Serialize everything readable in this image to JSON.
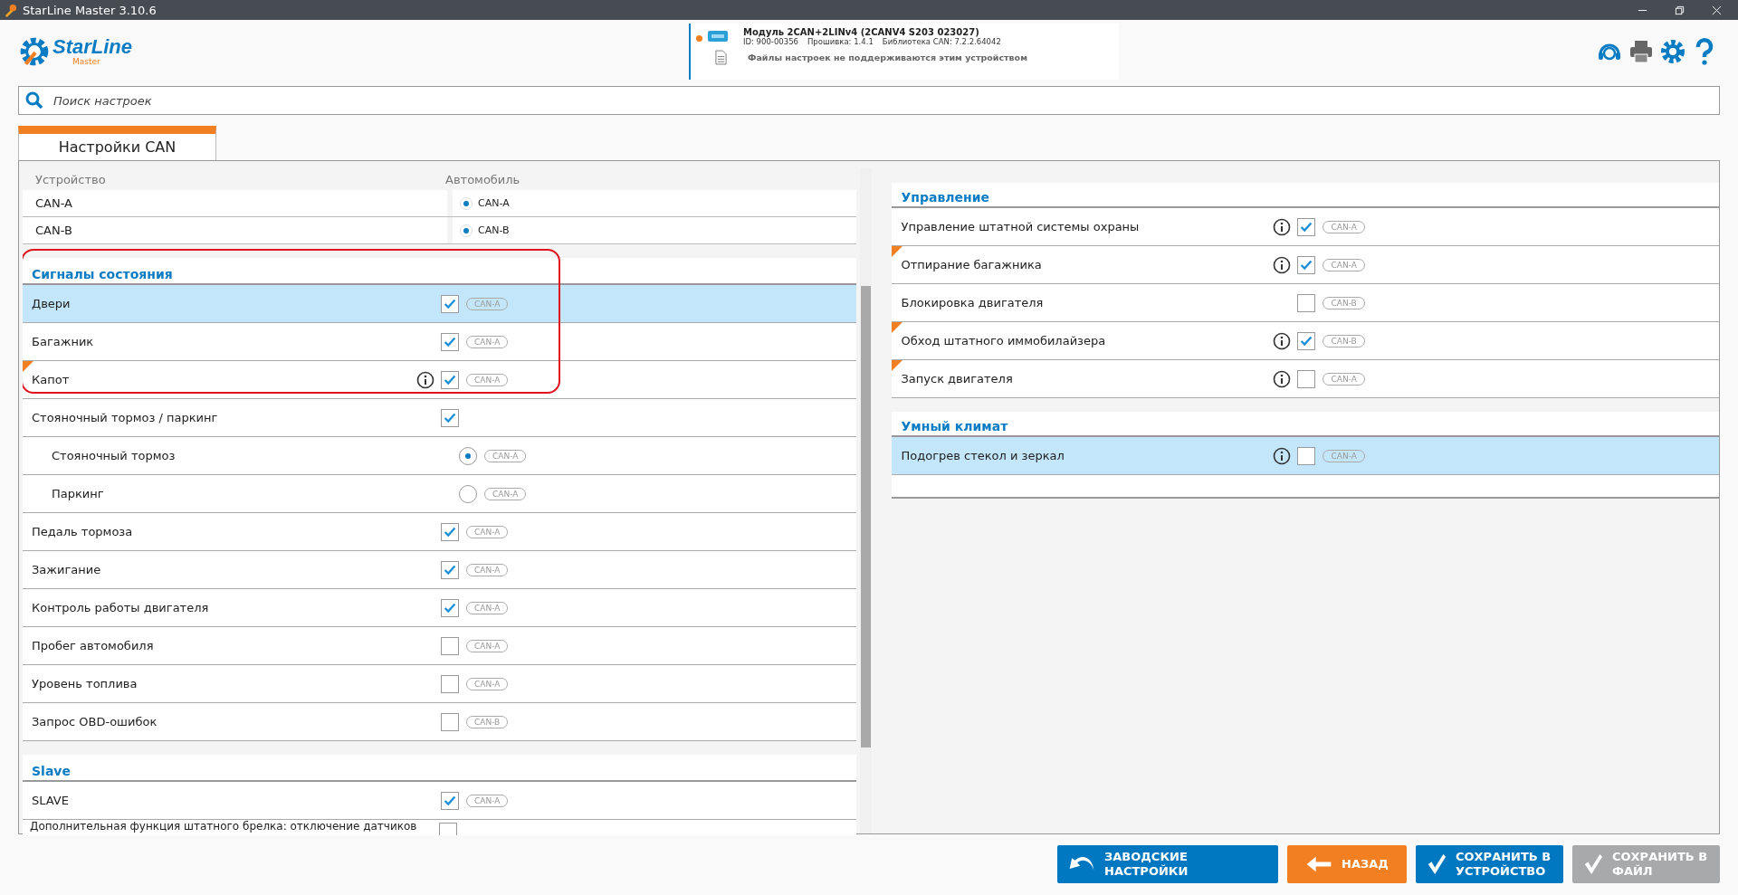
{
  "window": {
    "title": "StarLine Master 3.10.6"
  },
  "logo": {
    "name": "StarLine",
    "sub": "Master"
  },
  "device": {
    "connected": true,
    "name": "Модуль 2CAN+2LINv4 (2CANV4 S203 023027)",
    "id": "ID: 900-00356",
    "firmware": "Прошивка: 1.4.1",
    "library": "Библиотека CAN: 7.2.2.64042",
    "notice": "Файлы настроек не поддерживаются этим устройством"
  },
  "search": {
    "placeholder": "Поиск настроек"
  },
  "tabs": [
    {
      "label": "Настройки CAN",
      "selected": true
    }
  ],
  "bus_table": {
    "columns": [
      "Устройство",
      "Автомобиль"
    ],
    "rows": [
      {
        "label": "CAN-A",
        "value": "CAN-A",
        "selected": true
      },
      {
        "label": "CAN-B",
        "value": "CAN-B",
        "selected": true
      }
    ]
  },
  "left_sections": [
    {
      "title": "Сигналы состояния",
      "rows": [
        {
          "label": "Двери",
          "kind": "check",
          "checked": true,
          "bus": "CAN-A",
          "highlighted": true
        },
        {
          "label": "Багажник",
          "kind": "check",
          "checked": true,
          "bus": "CAN-A"
        },
        {
          "label": "Капот",
          "kind": "check",
          "checked": true,
          "bus": "CAN-A",
          "info": true,
          "flagged": true
        },
        {
          "label": "Стояночный тормоз / паркинг",
          "kind": "check",
          "checked": true,
          "children": [
            {
              "label": "Стояночный тормоз",
              "kind": "radio",
              "selected": true,
              "bus": "CAN-A"
            },
            {
              "label": "Паркинг",
              "kind": "radio",
              "selected": false,
              "bus": "CAN-A"
            }
          ]
        },
        {
          "label": "Педаль тормоза",
          "kind": "check",
          "checked": true,
          "bus": "CAN-A"
        },
        {
          "label": "Зажигание",
          "kind": "check",
          "checked": true,
          "bus": "CAN-A"
        },
        {
          "label": "Контроль работы двигателя",
          "kind": "check",
          "checked": true,
          "bus": "CAN-A"
        },
        {
          "label": "Пробег автомобиля",
          "kind": "check",
          "checked": false,
          "bus": "CAN-A"
        },
        {
          "label": "Уровень топлива",
          "kind": "check",
          "checked": false,
          "bus": "CAN-A"
        },
        {
          "label": "Запрос OBD-ошибок",
          "kind": "check",
          "checked": false,
          "bus": "CAN-B"
        }
      ]
    },
    {
      "title": "Slave",
      "rows": [
        {
          "label": "SLAVE",
          "kind": "check",
          "checked": true,
          "bus": "CAN-A"
        },
        {
          "label": "Дополнительная функция штатного брелка: отключение датчиков",
          "kind": "check",
          "checked": false
        }
      ]
    }
  ],
  "right_sections": [
    {
      "title": "Управление",
      "rows": [
        {
          "label": "Управление штатной системы охраны",
          "kind": "check",
          "checked": true,
          "bus": "CAN-A",
          "info": true
        },
        {
          "label": "Отпирание багажника",
          "kind": "check",
          "checked": true,
          "bus": "CAN-A",
          "info": true,
          "flagged": true
        },
        {
          "label": "Блокировка двигателя",
          "kind": "check",
          "checked": false,
          "bus": "CAN-B"
        },
        {
          "label": "Обход штатного иммобилайзера",
          "kind": "check",
          "checked": true,
          "bus": "CAN-B",
          "info": true,
          "flagged": true
        },
        {
          "label": "Запуск двигателя",
          "kind": "check",
          "checked": false,
          "bus": "CAN-A",
          "info": true,
          "flagged": true
        }
      ]
    },
    {
      "title": "Умный климат",
      "rows": [
        {
          "label": "Подогрев стекол и зеркал",
          "kind": "check",
          "checked": false,
          "bus": "CAN-A",
          "info": true,
          "highlighted": true
        }
      ]
    }
  ],
  "buttons": [
    {
      "label": "ЗАВОДСКИЕ НАСТРОЙКИ",
      "kind": "reset",
      "disabled": false
    },
    {
      "label": "НАЗАД",
      "kind": "back",
      "disabled": false
    },
    {
      "label": "СОХРАНИТЬ В УСТРОЙСТВО",
      "kind": "save",
      "disabled": false
    },
    {
      "label": "СОХРАНИТЬ В ФАЙЛ",
      "kind": "save",
      "disabled": true
    }
  ]
}
